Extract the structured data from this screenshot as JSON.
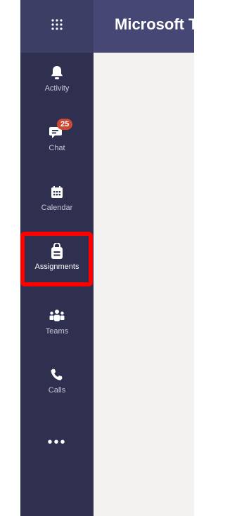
{
  "header": {
    "title": "Microsoft Teams",
    "app_launcher_icon": "waffle-grid-icon"
  },
  "sidebar": {
    "items": [
      {
        "label": "Activity",
        "icon": "bell-icon"
      },
      {
        "label": "Chat",
        "icon": "chat-icon",
        "badge": "25"
      },
      {
        "label": "Calendar",
        "icon": "calendar-icon"
      },
      {
        "label": "Assignments",
        "icon": "assignment-bag-icon",
        "active": true
      },
      {
        "label": "Teams",
        "icon": "teams-icon"
      },
      {
        "label": "Calls",
        "icon": "phone-icon"
      }
    ],
    "more_label": "•••"
  },
  "colors": {
    "rail": "#2f2f4f",
    "topbar": "#464775",
    "badge": "#cc4a31",
    "highlight": "#ff0000"
  }
}
